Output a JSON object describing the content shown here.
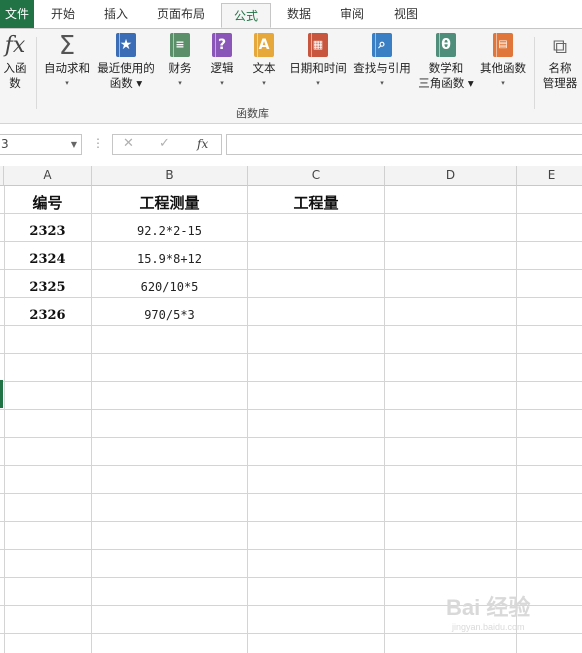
{
  "ribbon": {
    "tabs": [
      {
        "label": "文件",
        "state": "file"
      },
      {
        "label": "开始",
        "state": "normal"
      },
      {
        "label": "插入",
        "state": "normal"
      },
      {
        "label": "页面布局",
        "state": "normal"
      },
      {
        "label": "公式",
        "state": "active"
      },
      {
        "label": "数据",
        "state": "normal"
      },
      {
        "label": "审阅",
        "state": "normal"
      },
      {
        "label": "视图",
        "state": "normal"
      }
    ],
    "buttons": {
      "insert_function": {
        "label": "入函数",
        "icon": "fx-icon"
      },
      "autosum": {
        "label1": "自动求和",
        "label2": "▾",
        "icon": "sigma-icon"
      },
      "recent": {
        "label1": "最近使用的",
        "label2": "函数 ▾",
        "icon": "star-book-icon",
        "color": "#3a6db5"
      },
      "financial": {
        "label1": "财务",
        "label2": "▾",
        "icon": "coins-book-icon",
        "color": "#5a8f6a"
      },
      "logical": {
        "label1": "逻辑",
        "label2": "▾",
        "icon": "question-book-icon",
        "color": "#8a56b8"
      },
      "text": {
        "label1": "文本",
        "label2": "▾",
        "icon": "letter-a-book-icon",
        "color": "#e6a83a"
      },
      "datetime": {
        "label1": "日期和时间",
        "label2": "▾",
        "icon": "calendar-book-icon",
        "color": "#c8553d"
      },
      "lookup": {
        "label1": "查找与引用",
        "label2": "▾",
        "icon": "magnifier-book-icon",
        "color": "#3a7fc4"
      },
      "math": {
        "label1": "数学和",
        "label2": "三角函数 ▾",
        "icon": "theta-book-icon",
        "color": "#4f8e7a"
      },
      "more": {
        "label1": "其他函数",
        "label2": "▾",
        "icon": "grid-book-icon",
        "color": "#e0763a"
      },
      "name_manager": {
        "label1": "名称",
        "label2": "管理器",
        "icon": "tags-icon"
      }
    },
    "group_label": "函数库"
  },
  "formula_bar": {
    "name_box": "3",
    "cancel_icon": "✕",
    "enter_icon": "✓",
    "fx_label": "fx",
    "value": ""
  },
  "columns": [
    "A",
    "B",
    "C",
    "D",
    "E"
  ],
  "rows": [
    {
      "a": "编号",
      "b": "工程测量",
      "c": "工程量"
    },
    {
      "a": "2323",
      "b": "92.2*2-15",
      "c": ""
    },
    {
      "a": "2324",
      "b": "15.9*8+12",
      "c": ""
    },
    {
      "a": "2325",
      "b": "620/10*5",
      "c": ""
    },
    {
      "a": "2326",
      "b": "970/5*3",
      "c": ""
    }
  ],
  "watermark": {
    "text": "Bai 经验",
    "url": "jingyan.baidu.com"
  }
}
